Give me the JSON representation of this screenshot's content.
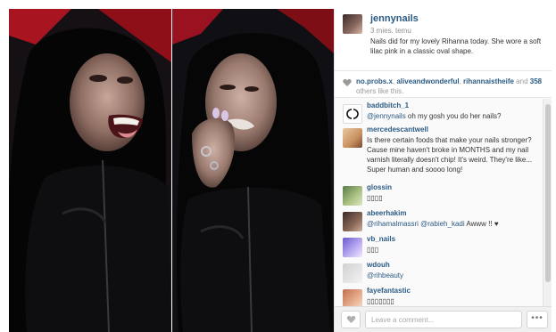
{
  "post": {
    "author": "jennynails",
    "time": "3 mies. temu",
    "caption": "Nails did for my lovely Rihanna today. She wore a soft lilac pink in a classic oval shape."
  },
  "likes": {
    "user1": "no.probs.x",
    "user2": "aliveandwonderful",
    "user3": "rihannaistheife",
    "and_text": "and",
    "count": "358",
    "suffix": "others like this."
  },
  "comments": [
    {
      "user": "baddbitch_1",
      "mention": "@jennynails",
      "text": " oh my gosh you do her nails?",
      "avatar_icon": "chanel-logo-icon"
    },
    {
      "user": "mercedescantwell",
      "mention": "",
      "text": "Is there certain foods that make your nails stronger? Cause mine haven't broke in MONTHS and my nail varnish literally doesn't chip! It's weird. They're like... Super human and soooo long!",
      "avatar_icon": "user-avatar"
    },
    {
      "user": "glossin",
      "mention": "",
      "text": "▯▯▯▯",
      "avatar_icon": "user-avatar"
    },
    {
      "user": "abeerhakim",
      "mention": "@rihamalmassri @rabieh_kadi",
      "text": " Awww !! ♥",
      "avatar_icon": "user-avatar"
    },
    {
      "user": "vb_nails",
      "mention": "",
      "text": "▯▯▯",
      "avatar_icon": "user-avatar"
    },
    {
      "user": "wdouh",
      "mention": "@rihbeauty",
      "text": "",
      "avatar_icon": "user-avatar"
    },
    {
      "user": "fayefantastic",
      "mention": "",
      "text": "▯▯▯▯▯▯▯",
      "avatar_icon": "user-avatar"
    }
  ],
  "footer": {
    "comment_placeholder": "Leave a comment...",
    "more_label": "•••"
  },
  "colors": {
    "link": "#2b5a83",
    "panel_bg": "#fafafa",
    "photo_bg": "#0a0a0c",
    "accent_red": "#c0121c"
  }
}
